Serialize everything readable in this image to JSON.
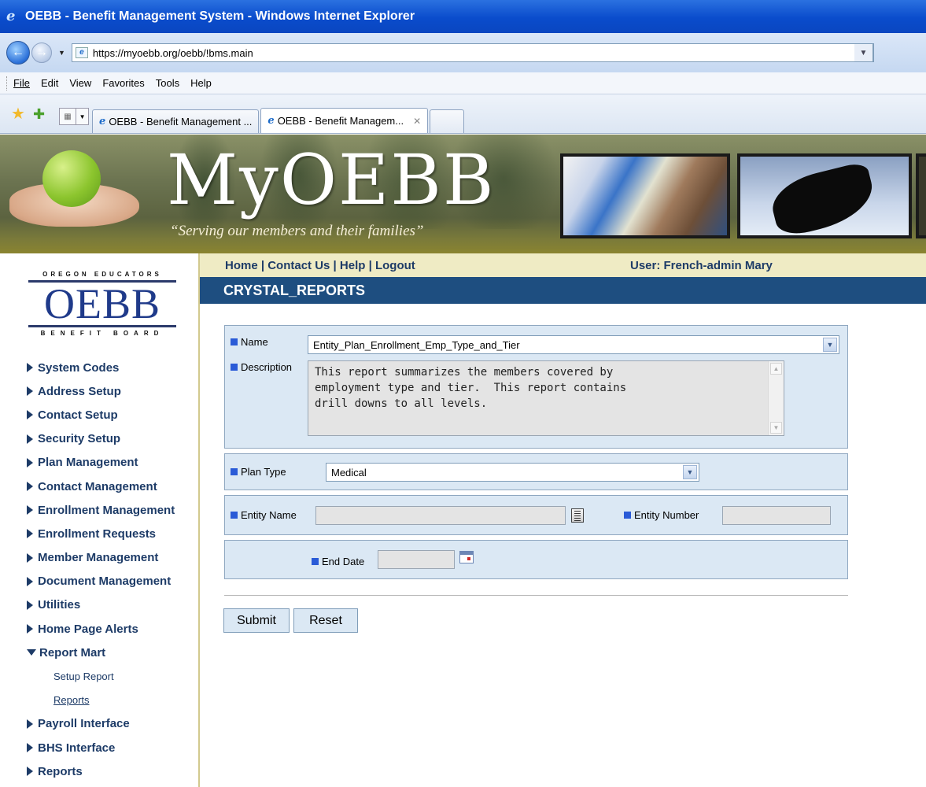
{
  "browser": {
    "window_title": "OEBB - Benefit Management System - Windows Internet Explorer",
    "url": "https://myoebb.org/oebb/!bms.main",
    "menu": [
      "File",
      "Edit",
      "View",
      "Favorites",
      "Tools",
      "Help"
    ],
    "tabs": [
      {
        "label": "OEBB - Benefit Management ...",
        "active": false
      },
      {
        "label": "OEBB - Benefit Managem...",
        "active": true
      }
    ]
  },
  "banner": {
    "logo_text": "MyOEBB",
    "tagline": "“Serving our members and their families”"
  },
  "org_logo": {
    "top": "OREGON EDUCATORS",
    "main": "OEBB",
    "bottom": "BENEFIT BOARD"
  },
  "sidebar": {
    "items": [
      {
        "label": "System Codes"
      },
      {
        "label": "Address Setup"
      },
      {
        "label": "Contact Setup"
      },
      {
        "label": "Security Setup"
      },
      {
        "label": "Plan Management"
      },
      {
        "label": "Contact Management"
      },
      {
        "label": "Enrollment Management"
      },
      {
        "label": "Enrollment Requests"
      },
      {
        "label": "Member Management"
      },
      {
        "label": "Document Management"
      },
      {
        "label": "Utilities"
      },
      {
        "label": "Home Page Alerts"
      },
      {
        "label": "Report Mart",
        "expanded": true
      },
      {
        "label": "Payroll Interface"
      },
      {
        "label": "BHS Interface"
      },
      {
        "label": "Reports"
      }
    ],
    "report_mart_children": [
      {
        "label": "Setup Report"
      },
      {
        "label": "Reports"
      }
    ]
  },
  "topnav": {
    "links": "Home | Contact Us | Help | Logout",
    "user": "User: French-admin Mary"
  },
  "page": {
    "heading": "CRYSTAL_REPORTS"
  },
  "form": {
    "name_label": "Name",
    "name_value": "Entity_Plan_Enrollment_Emp_Type_and_Tier",
    "description_label": "Description",
    "description_value": "This report summarizes the members covered by\nemployment type and tier.  This report contains\ndrill downs to all levels.",
    "plan_type_label": "Plan Type",
    "plan_type_value": "Medical",
    "entity_name_label": "Entity Name",
    "entity_name_value": "",
    "entity_number_label": "Entity Number",
    "entity_number_value": "",
    "end_date_label": "End Date",
    "end_date_value": ""
  },
  "buttons": {
    "submit": "Submit",
    "reset": "Reset"
  },
  "colors": {
    "heading_bar": "#1e4e80",
    "nav_text": "#1d3b67",
    "panel_bg": "#dbe8f4",
    "topnav_bg": "#efebc4"
  }
}
